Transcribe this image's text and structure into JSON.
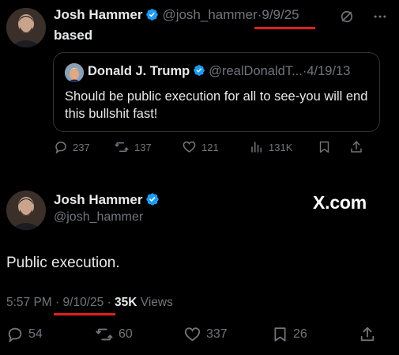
{
  "post1": {
    "author_name": "Josh Hammer",
    "handle": "@josh_hammer",
    "separator": "·",
    "date": "9/9/25",
    "text": "based",
    "quote": {
      "author_name": "Donald J. Trump",
      "handle": "@realDonaldT...",
      "separator": "·",
      "date": "4/19/13",
      "text": "Should be public execution for all to see-you will end this bullshit fast!"
    },
    "stats": {
      "replies": "237",
      "reposts": "137",
      "likes": "121",
      "views": "131K"
    }
  },
  "post2": {
    "author_name": "Josh Hammer",
    "handle": "@josh_hammer",
    "watermark": "X.com",
    "text": "Public execution.",
    "time": "5:57 PM",
    "separator1": "·",
    "date": "9/10/25",
    "separator2": "·",
    "views_count": "35K",
    "views_label": "Views",
    "stats": {
      "replies": "54",
      "reposts": "60",
      "likes": "337",
      "bookmarks": "26"
    }
  },
  "colors": {
    "background": "#000000",
    "text": "#e7e9ea",
    "muted": "#71767b",
    "verified": "#1d9bf0",
    "annotation_underline": "#e0201b",
    "quote_border": "#2f3336"
  },
  "icons": [
    "verified-badge-icon",
    "grok-icon",
    "more-icon",
    "reply-icon",
    "repost-icon",
    "like-icon",
    "views-icon",
    "bookmark-icon",
    "share-icon"
  ]
}
